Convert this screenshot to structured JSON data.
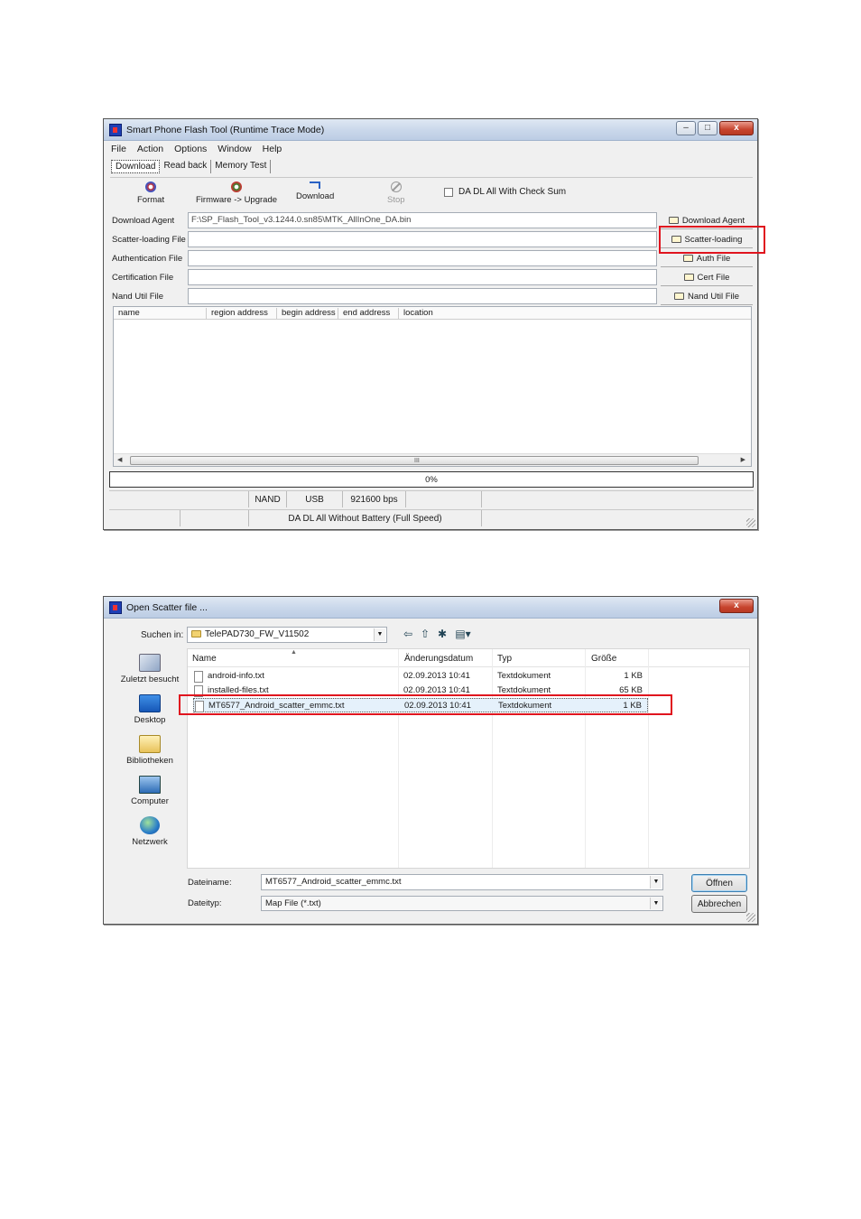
{
  "flash_window": {
    "title": "Smart Phone Flash Tool (Runtime Trace Mode)",
    "menu": [
      "File",
      "Action",
      "Options",
      "Window",
      "Help"
    ],
    "tabs": [
      "Download",
      "Read back",
      "Memory Test"
    ],
    "toolbar": {
      "format": "Format",
      "firmware_upgrade": "Firmware -> Upgrade",
      "download": "Download",
      "stop": "Stop",
      "checksum_label": "DA DL All With Check Sum"
    },
    "fields": [
      {
        "label": "Download Agent",
        "value": "F:\\SP_Flash_Tool_v3.1244.0.sn85\\MTK_AllInOne_DA.bin",
        "button": "Download Agent"
      },
      {
        "label": "Scatter-loading File",
        "value": "",
        "button": "Scatter-loading"
      },
      {
        "label": "Authentication File",
        "value": "",
        "button": "Auth File"
      },
      {
        "label": "Certification File",
        "value": "",
        "button": "Cert File"
      },
      {
        "label": "Nand Util File",
        "value": "",
        "button": "Nand Util File"
      }
    ],
    "list_columns": [
      "name",
      "region address",
      "begin address",
      "end address",
      "location"
    ],
    "scroll_grip": "III",
    "progress": {
      "text": "0%",
      "fraction": 0
    },
    "status1": [
      "NAND",
      "USB",
      "921600 bps"
    ],
    "status2": "DA DL All Without Battery (Full Speed)"
  },
  "dialog": {
    "title": "Open Scatter file ...",
    "look_in_label": "Suchen in:",
    "look_in_value": "TelePAD730_FW_V11502",
    "places": [
      "Zuletzt besucht",
      "Desktop",
      "Bibliotheken",
      "Computer",
      "Netzwerk"
    ],
    "columns": [
      "Name",
      "Änderungsdatum",
      "Typ",
      "Größe"
    ],
    "files": [
      {
        "name": "android-info.txt",
        "date": "02.09.2013 10:41",
        "type": "Textdokument",
        "size": "1 KB"
      },
      {
        "name": "installed-files.txt",
        "date": "02.09.2013 10:41",
        "type": "Textdokument",
        "size": "65 KB"
      },
      {
        "name": "MT6577_Android_scatter_emmc.txt",
        "date": "02.09.2013 10:41",
        "type": "Textdokument",
        "size": "1 KB"
      }
    ],
    "filename_label": "Dateiname:",
    "filename_value": "MT6577_Android_scatter_emmc.txt",
    "filetype_label": "Dateityp:",
    "filetype_value": "Map File (*.txt)",
    "open_button": "Öffnen",
    "cancel_button": "Abbrechen"
  },
  "colors": {
    "highlight_box": "#e0141e",
    "titlebar": "#c9d7ea"
  }
}
